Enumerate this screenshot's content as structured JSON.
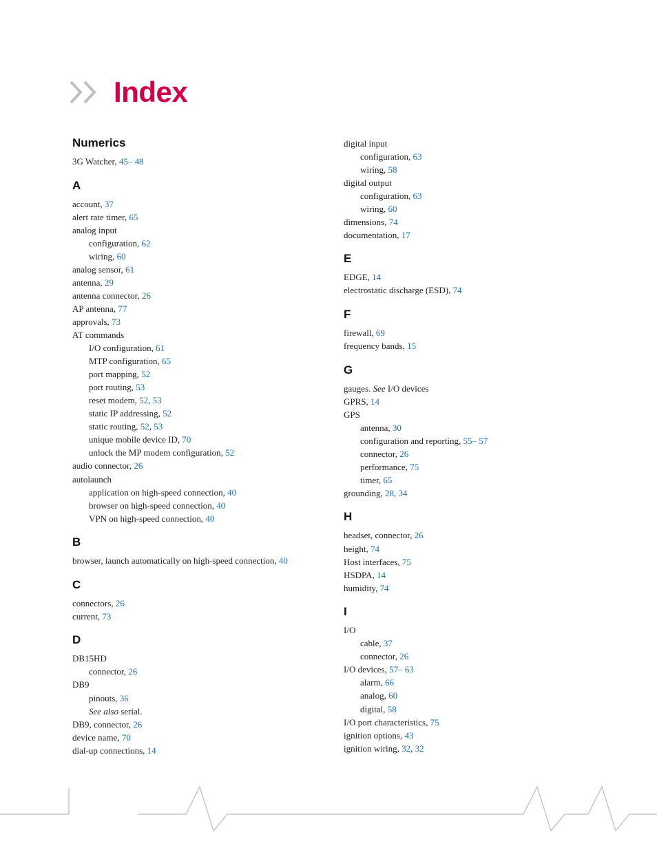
{
  "title_color": "#d2004a",
  "link_color": "#1a6fb3",
  "title": "Index",
  "sections": {
    "numerics": "Numerics",
    "a": "A",
    "b": "B",
    "c": "C",
    "d": "D",
    "e": "E",
    "f": "F",
    "g": "G",
    "h": "H",
    "i": "I"
  },
  "entries": {
    "g3watcher": "3G Watcher",
    "g3watcher_p": "45– 48",
    "account": "account",
    "account_p": "37",
    "alert_rate": "alert rate timer",
    "alert_rate_p": "65",
    "analog_input": "analog input",
    "analog_input_cfg": "configuration",
    "analog_input_cfg_p": "62",
    "analog_input_wiring": "wiring",
    "analog_input_wiring_p": "60",
    "analog_sensor": "analog sensor",
    "analog_sensor_p": "61",
    "antenna": "antenna",
    "antenna_p": "29",
    "antenna_conn": "antenna connector",
    "antenna_conn_p": "26",
    "ap_antenna": "AP antenna",
    "ap_antenna_p": "77",
    "approvals": "approvals",
    "approvals_p": "73",
    "at_cmds": "AT commands",
    "at_io": "I/O configuration",
    "at_io_p": "61",
    "at_mtp": "MTP configuration",
    "at_mtp_p": "65",
    "at_portmap": "port mapping",
    "at_portmap_p": "52",
    "at_portroute": "port routing",
    "at_portroute_p": "53",
    "at_reset": "reset modem",
    "at_reset_p1": "52",
    "at_reset_p2": "53",
    "at_staticip": "static IP addressing",
    "at_staticip_p": "52",
    "at_staticroute": "static routing",
    "at_staticroute_p1": "52",
    "at_staticroute_p2": "53",
    "at_umdi": "unique mobile device ID",
    "at_umdi_p": "70",
    "at_unlock": "unlock the MP modem configuration",
    "at_unlock_p": "52",
    "audio_conn": "audio connector",
    "audio_conn_p": "26",
    "autolaunch": "autolaunch",
    "al_app": "application on high-speed connection",
    "al_app_p": "40",
    "al_browser": "browser on high-speed connection",
    "al_browser_p": "40",
    "al_vpn": "VPN on high-speed connection",
    "al_vpn_p": "40",
    "browser_launch": "browser, launch automatically on high-speed connection",
    "browser_launch_p": "40",
    "connectors": "connectors",
    "connectors_p": "26",
    "current": "current",
    "current_p": "73",
    "db15hd": "DB15HD",
    "db15hd_conn": "connector",
    "db15hd_conn_p": "26",
    "db9": "DB9",
    "db9_pinouts": "pinouts",
    "db9_pinouts_p": "36",
    "db9_seealso_pre": "See also",
    "db9_seealso_post": " serial.",
    "db9_conn": "DB9, connector",
    "db9_conn_p": "26",
    "device_name": "device name",
    "device_name_p": "70",
    "dialup": "dial-up connections",
    "dialup_p": "14",
    "digital_input": "digital input",
    "di_cfg": "configuration",
    "di_cfg_p": "63",
    "di_wiring": "wiring",
    "di_wiring_p": "58",
    "digital_output": "digital output",
    "do_cfg": "configuration",
    "do_cfg_p": "63",
    "do_wiring": "wiring",
    "do_wiring_p": "60",
    "dimensions": "dimensions",
    "dimensions_p": "74",
    "documentation": "documentation",
    "documentation_p": "17",
    "edge": "EDGE",
    "edge_p": "14",
    "esd": "electrostatic discharge (ESD)",
    "esd_p": "74",
    "firewall": "firewall",
    "firewall_p": "69",
    "freq": "frequency bands",
    "freq_p": "15",
    "gauges_pre": "gauges. ",
    "gauges_see": "See",
    "gauges_post": " I/O devices",
    "gprs": "GPRS",
    "gprs_p": "14",
    "gps": "GPS",
    "gps_antenna": "antenna",
    "gps_antenna_p": "30",
    "gps_cfg": "configuration and reporting",
    "gps_cfg_p": "55– 57",
    "gps_conn": "connector",
    "gps_conn_p": "26",
    "gps_perf": "performance",
    "gps_perf_p": "75",
    "gps_timer": "timer",
    "gps_timer_p": "65",
    "grounding": "grounding",
    "grounding_p1": "28",
    "grounding_p2": "34",
    "headset": "headset, connector",
    "headset_p": "26",
    "height": "height",
    "height_p": "74",
    "hostif": "Host interfaces",
    "hostif_p": "75",
    "hsdpa": "HSDPA",
    "hsdpa_p": "14",
    "humidity": "humidity",
    "humidity_p": "74",
    "io": "I/O",
    "io_cable": "cable",
    "io_cable_p": "37",
    "io_conn": "connector",
    "io_conn_p": "26",
    "io_devices": "I/O devices",
    "io_devices_p": "57– 63",
    "iod_alarm": "alarm",
    "iod_alarm_p": "66",
    "iod_analog": "analog",
    "iod_analog_p": "60",
    "iod_digital": "digital",
    "iod_digital_p": "58",
    "io_port": "I/O port characteristics",
    "io_port_p": "75",
    "ign_opt": "ignition options",
    "ign_opt_p": "43",
    "ign_wiring": "ignition wiring",
    "ign_wiring_p1": "32",
    "ign_wiring_p2": "32"
  }
}
